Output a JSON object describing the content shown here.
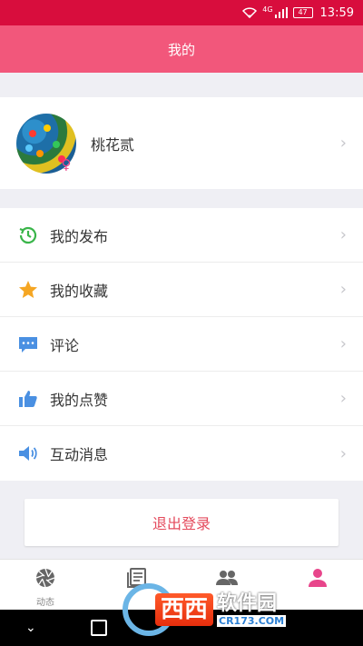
{
  "status_bar": {
    "network": "4G",
    "battery": "47",
    "time": "13:59"
  },
  "title_bar": {
    "title": "我的"
  },
  "profile": {
    "username": "桃花贰",
    "gender": "♀",
    "gender_color": "#e8458b"
  },
  "menu": {
    "items": [
      {
        "label": "我的发布",
        "icon": "history-icon",
        "color": "#3ab54a"
      },
      {
        "label": "我的收藏",
        "icon": "star-icon",
        "color": "#f5a623"
      },
      {
        "label": "评论",
        "icon": "comment-icon",
        "color": "#4a90e2"
      },
      {
        "label": "我的点赞",
        "icon": "thumbs-up-icon",
        "color": "#4a90e2"
      },
      {
        "label": "互动消息",
        "icon": "speaker-icon",
        "color": "#4a90e2"
      }
    ]
  },
  "logout": {
    "label": "退出登录",
    "color": "#e44a5c"
  },
  "tabbar": {
    "tabs": [
      {
        "label": "动态",
        "icon": "aperture-icon",
        "active": false
      },
      {
        "label": "",
        "icon": "list-icon",
        "active": false
      },
      {
        "label": "",
        "icon": "people-icon",
        "active": false
      },
      {
        "label": "",
        "icon": "user-icon",
        "active": true
      }
    ],
    "active_color": "#e8458b"
  },
  "watermark": {
    "box_text": "西西",
    "title": "软件园",
    "url": "CR173.COM"
  },
  "colors": {
    "status_bar": "#d80d3d",
    "title_bar": "#f2577b",
    "background": "#efeff4"
  }
}
